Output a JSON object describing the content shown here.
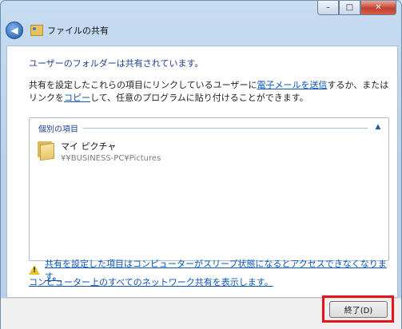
{
  "window": {
    "title": "ファイルの共有",
    "controls": [
      "minimize-icon",
      "maximize-icon",
      "close-icon"
    ]
  },
  "content": {
    "heading": "ユーザーのフォルダーは共有されています。",
    "desc_part1": "共有を設定したこれらの項目にリンクしているユーザーに",
    "desc_link_email": "電子メールを送信",
    "desc_part2": "するか、またはリンクを",
    "desc_link_copy": "コピー",
    "desc_part3": "して、任意のプログラムに貼り付けることができます。",
    "group_title": "個別の項目",
    "item": {
      "name": "マイ ピクチャ",
      "path": "¥¥BUSINESS-PC¥Pictures",
      "icon": "folder-icon"
    },
    "warning_link": "共有を設定した項目はコンピューターがスリープ状態になるとアクセスできなくなります。",
    "show_all_link": "コンピューター上のすべてのネットワーク共有を表示します。"
  },
  "footer": {
    "finish_label": "終了(D)"
  },
  "colors": {
    "highlight": "#e8131a",
    "link": "#0a56b8",
    "heading": "#1f3e95"
  }
}
